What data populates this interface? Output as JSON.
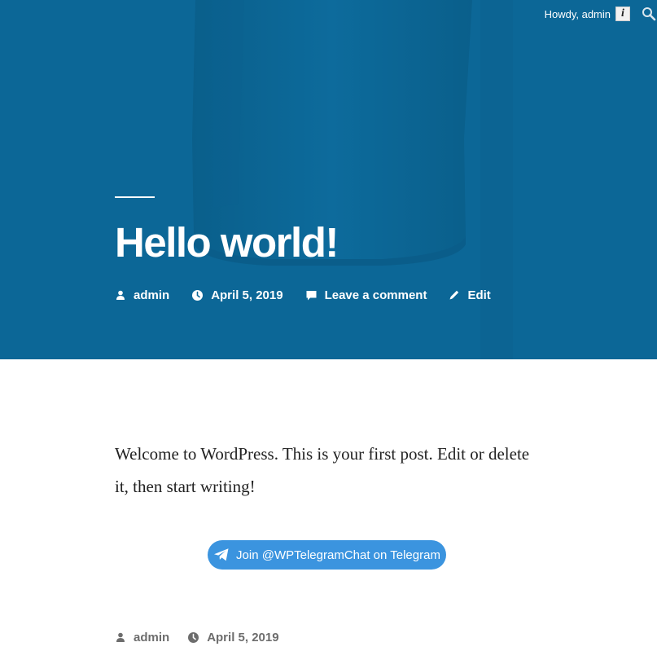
{
  "admin_bar": {
    "greeting": "Howdy, admin",
    "avatar_glyph": "i",
    "search_icon": "search-icon"
  },
  "colors": {
    "hero_bg": "#0c6797",
    "button_bg": "#3b94df",
    "text": "#222222",
    "meta_muted": "#6d6d6d"
  },
  "post": {
    "title": "Hello world!",
    "author": "admin",
    "date": "April 5, 2019",
    "comment_link": "Leave a comment",
    "edit_link": "Edit",
    "body": "Welcome to WordPress. This is your first post. Edit or delete it, then start writing!"
  },
  "telegram": {
    "button_label": "Join @WPTelegramChat on Telegram",
    "icon": "telegram-plane-icon"
  },
  "footer_meta": {
    "author": "admin",
    "date": "April 5, 2019"
  }
}
